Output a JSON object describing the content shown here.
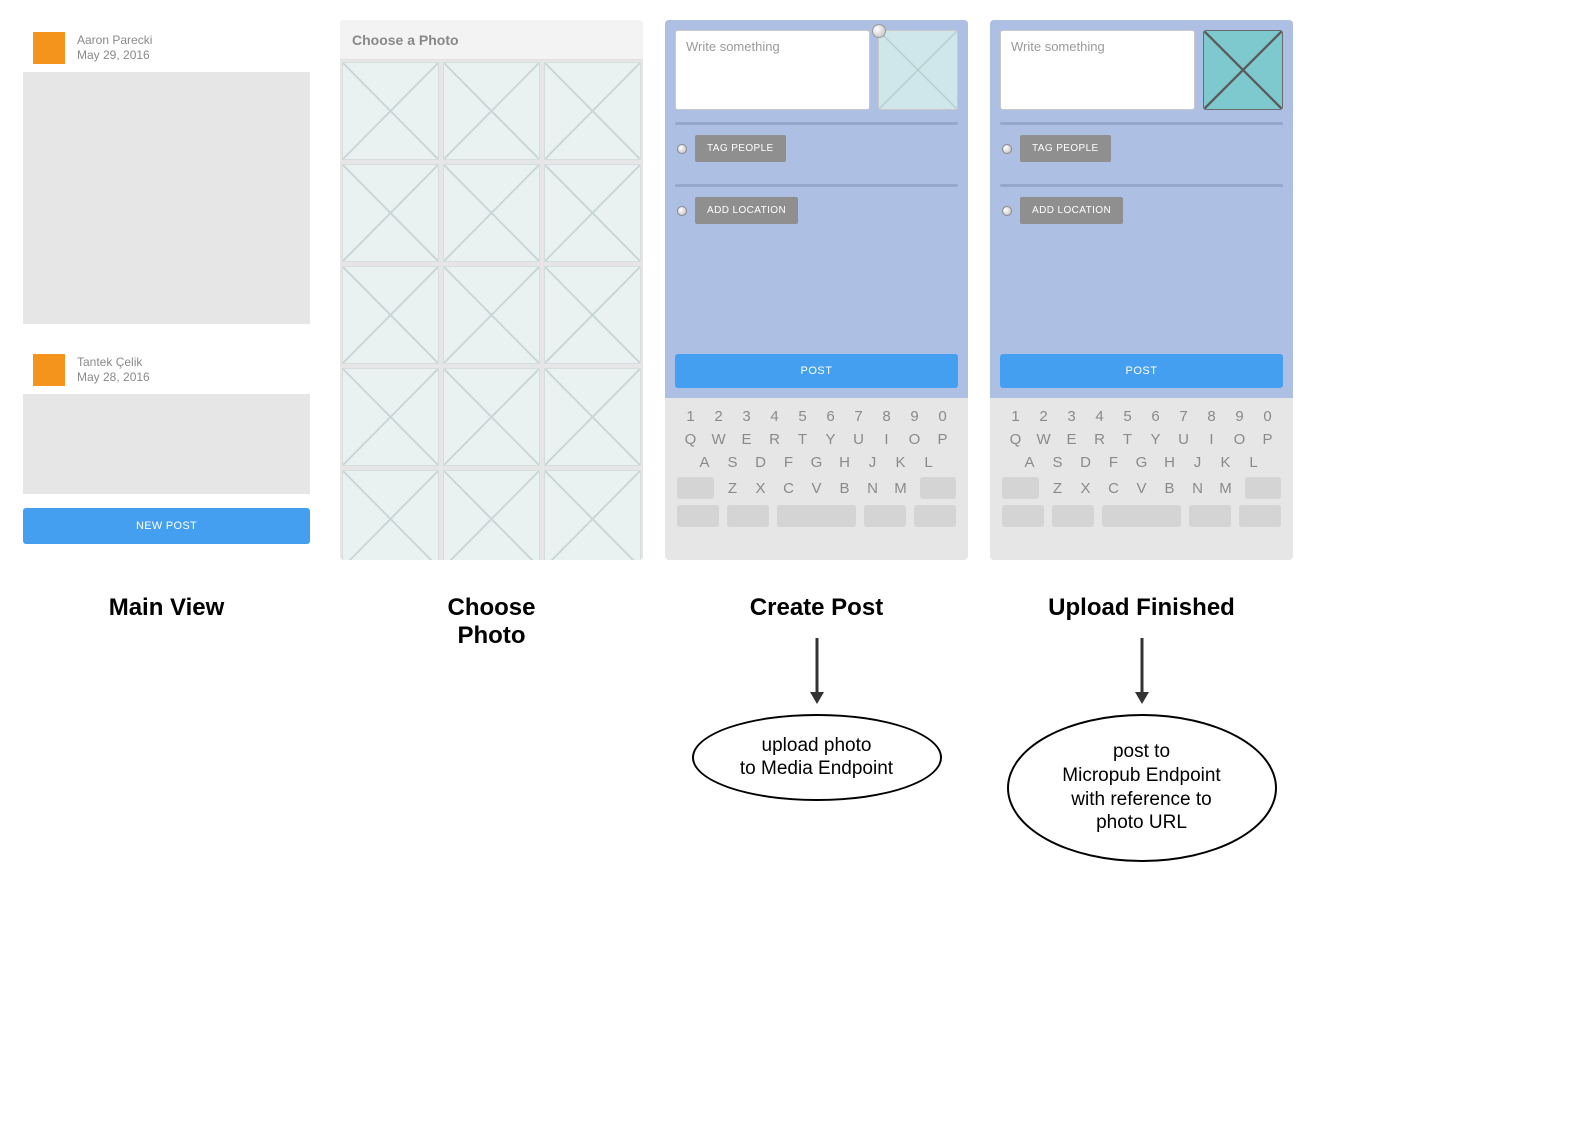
{
  "main_view": {
    "posts": [
      {
        "name": "Aaron Parecki",
        "date": "May 29, 2016"
      },
      {
        "name": "Tantek Çelik",
        "date": "May 28, 2016"
      }
    ],
    "new_post_label": "NEW POST"
  },
  "choose_photo": {
    "header": "Choose a Photo"
  },
  "compose": {
    "placeholder": "Write something",
    "tag_people_label": "TAG PEOPLE",
    "add_location_label": "ADD LOCATION",
    "post_label": "POST"
  },
  "keyboard": {
    "row_nums": [
      "1",
      "2",
      "3",
      "4",
      "5",
      "6",
      "7",
      "8",
      "9",
      "0"
    ],
    "row_q": [
      "Q",
      "W",
      "E",
      "R",
      "T",
      "Y",
      "U",
      "I",
      "O",
      "P"
    ],
    "row_a": [
      "A",
      "S",
      "D",
      "F",
      "G",
      "H",
      "J",
      "K",
      "L"
    ],
    "row_z": [
      "Z",
      "X",
      "C",
      "V",
      "B",
      "N",
      "M"
    ]
  },
  "captions": {
    "main_view": "Main View",
    "choose_photo_l1": "Choose",
    "choose_photo_l2": "Photo",
    "create_post": "Create Post",
    "upload_finished": "Upload Finished"
  },
  "bubbles": {
    "create_post_l1": "upload photo",
    "create_post_l2": "to Media Endpoint",
    "upload_finished_l1": "post to",
    "upload_finished_l2": "Micropub Endpoint",
    "upload_finished_l3": "with reference to",
    "upload_finished_l4": "photo URL"
  }
}
